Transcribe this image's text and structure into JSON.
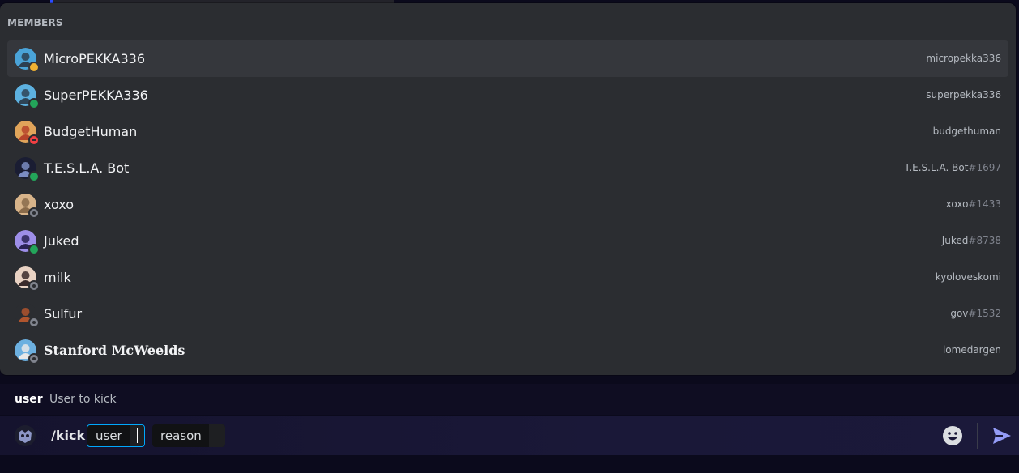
{
  "members_popup": {
    "header": "MEMBERS",
    "members": [
      {
        "display_name": "MicroPEKKA336",
        "username": "micropekka336",
        "discriminator": "",
        "status": "idle",
        "avatar_icon": "robot-avatar-icon",
        "avatar_colors": [
          "#4aa3d8",
          "#2c3f52"
        ],
        "serif": false
      },
      {
        "display_name": "SuperPEKKA336",
        "username": "superpekka336",
        "discriminator": "",
        "status": "online",
        "avatar_icon": "robot-avatar-icon",
        "avatar_colors": [
          "#5db1e0",
          "#2e4456"
        ],
        "serif": false
      },
      {
        "display_name": "BudgetHuman",
        "username": "budgethuman",
        "discriminator": "",
        "status": "dnd",
        "avatar_icon": "burger-avatar-icon",
        "avatar_colors": [
          "#e0a45a",
          "#b6452b"
        ],
        "serif": false
      },
      {
        "display_name": "T.E.S.L.A. Bot",
        "username": "T.E.S.L.A. Bot",
        "discriminator": "#1697",
        "status": "online",
        "avatar_icon": "bot-avatar-icon",
        "avatar_colors": [
          "#1a1d33",
          "#7b8cc2"
        ],
        "serif": false
      },
      {
        "display_name": "xoxo",
        "username": "xoxo",
        "discriminator": "#1433",
        "status": "offline",
        "avatar_icon": "portrait-avatar-icon",
        "avatar_colors": [
          "#d8b48a",
          "#8a6b4a"
        ],
        "serif": false
      },
      {
        "display_name": "Juked",
        "username": "Juked",
        "discriminator": "#8738",
        "status": "online",
        "avatar_icon": "crystal-avatar-icon",
        "avatar_colors": [
          "#9d8ee8",
          "#2a2356"
        ],
        "serif": false
      },
      {
        "display_name": "milk",
        "username": "kyoloveskomi",
        "discriminator": "",
        "status": "offline",
        "avatar_icon": "anime-avatar-icon",
        "avatar_colors": [
          "#e9d2c3",
          "#3a2a2a"
        ],
        "serif": false
      },
      {
        "display_name": "Sulfur",
        "username": "gov",
        "discriminator": "#1532",
        "status": "offline",
        "avatar_icon": "character-avatar-icon",
        "avatar_colors": [
          "#2b2d31",
          "#b0552e"
        ],
        "serif": false
      },
      {
        "display_name": "Stanford McWeelds",
        "username": "lomedargen",
        "discriminator": "",
        "status": "offline",
        "avatar_icon": "globe-avatar-icon",
        "avatar_colors": [
          "#6cb0e0",
          "#e8e8e8"
        ],
        "serif": true
      }
    ],
    "selected_index": 0
  },
  "hint": {
    "option_name": "user",
    "option_description": "User to kick"
  },
  "composer": {
    "command": "/kick",
    "options": [
      {
        "label": "user",
        "active": true
      },
      {
        "label": "reason",
        "active": false
      }
    ],
    "emoji_icon": "smiley-emoji-icon",
    "send_icon": "send-arrow-icon"
  },
  "colors": {
    "popup_bg": "#2b2d31",
    "selected_row": "#35373c",
    "online": "#23a55a",
    "idle": "#f0b232",
    "dnd": "#f23f43",
    "offline": "#80848e",
    "focus_border": "#00a8fc",
    "send": "#949cf7"
  }
}
